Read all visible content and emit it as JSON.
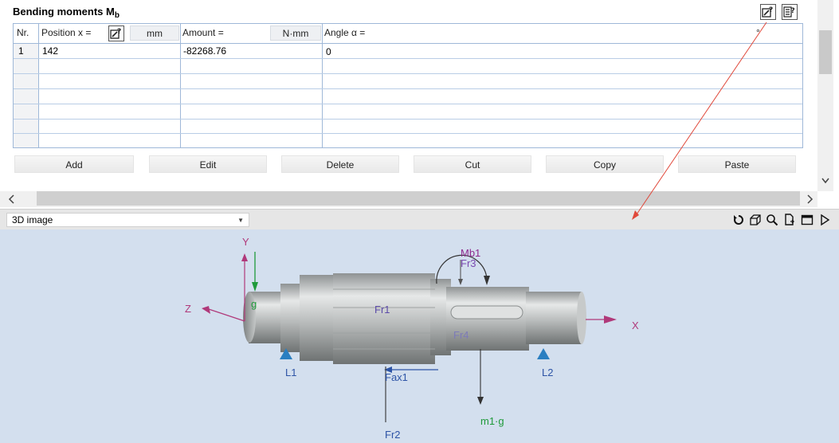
{
  "section": {
    "title": "Bending moments M",
    "subscript": "b"
  },
  "table": {
    "columns": {
      "nr": "Nr.",
      "position": "Position x =",
      "position_unit": "mm",
      "amount": "Amount =",
      "amount_unit": "N·mm",
      "angle": "Angle α =",
      "angle_unit": "°"
    },
    "rows": [
      {
        "nr": "1",
        "position": "142",
        "amount": "-82268.76",
        "angle": "0"
      }
    ]
  },
  "actions": {
    "add": "Add",
    "edit": "Edit",
    "delete": "Delete",
    "cut": "Cut",
    "copy": "Copy",
    "paste": "Paste"
  },
  "viewer": {
    "view_mode": "3D image",
    "labels": {
      "y": "Y",
      "z": "Z",
      "x": "X",
      "g": "g",
      "mb1": "Mb1",
      "fr3": "Fr3",
      "fr1": "Fr1",
      "fr4": "Fr4",
      "l1": "L1",
      "l2": "L2",
      "fax1": "Fax1",
      "m1g": "m1·g",
      "fr2": "Fr2"
    }
  },
  "colors": {
    "grid_border": "#9fb8d8",
    "viewport_bg": "#d3dfee",
    "axis_label": "#b0397a",
    "force_label": "#2d54a6",
    "bearing": "#2a7fc1",
    "moment": "#8e2a8e",
    "gravity": "#1f9a3a",
    "callout_line": "#e0483a"
  }
}
